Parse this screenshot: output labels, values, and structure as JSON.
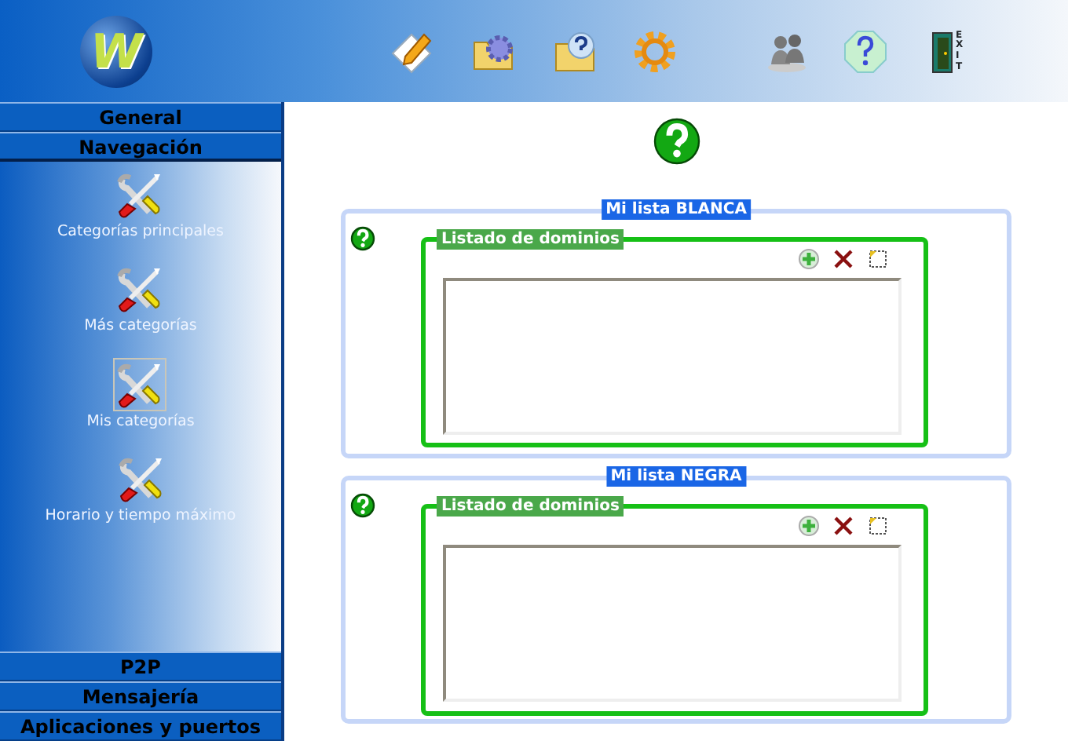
{
  "logo": {
    "letter": "W"
  },
  "toolbar": [
    {
      "kind": "edit"
    },
    {
      "kind": "folder-gear"
    },
    {
      "kind": "folder-help"
    },
    {
      "kind": "gear"
    },
    {
      "kind": "users"
    },
    {
      "kind": "help"
    },
    {
      "kind": "exit",
      "label": "EXIT"
    }
  ],
  "sidebar": {
    "top_sections": [
      {
        "label": "General",
        "expanded": false
      },
      {
        "label": "Navegación",
        "expanded": true
      }
    ],
    "items": [
      {
        "label": "Categorías principales",
        "selected": false
      },
      {
        "label": "Más categorías",
        "selected": false
      },
      {
        "label": "Mis categorías",
        "selected": true
      },
      {
        "label": "Horario y tiempo máximo",
        "selected": false
      }
    ],
    "bottom_sections": [
      {
        "label": "P2P",
        "expanded": false
      },
      {
        "label": "Mensajería",
        "expanded": false
      },
      {
        "label": "Aplicaciones y puertos",
        "expanded": false
      }
    ]
  },
  "panels": [
    {
      "title": "Mi lista BLANCA",
      "group": {
        "title": "Listado de dominios"
      }
    },
    {
      "title": "Mi lista NEGRA",
      "group": {
        "title": "Listado de dominios"
      }
    }
  ]
}
